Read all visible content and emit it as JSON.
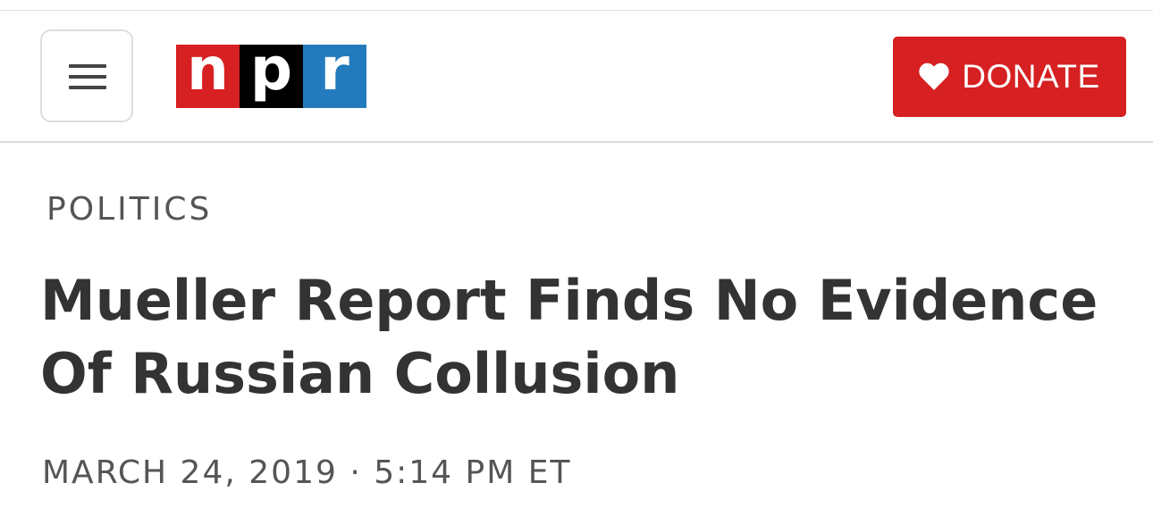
{
  "header": {
    "menu_icon": "hamburger-menu-icon",
    "logo": {
      "letters": [
        "n",
        "p",
        "r"
      ],
      "colors": [
        "#d62021",
        "#000000",
        "#237bbd"
      ]
    },
    "donate": {
      "icon": "heart-icon",
      "label": "DONATE",
      "color": "#d62021"
    }
  },
  "article": {
    "section": "POLITICS",
    "headline": "Mueller Report Finds No Evidence Of Russian Collusion",
    "date": "MARCH 24, 2019",
    "separator": "·",
    "time": "5:14 PM ET"
  }
}
